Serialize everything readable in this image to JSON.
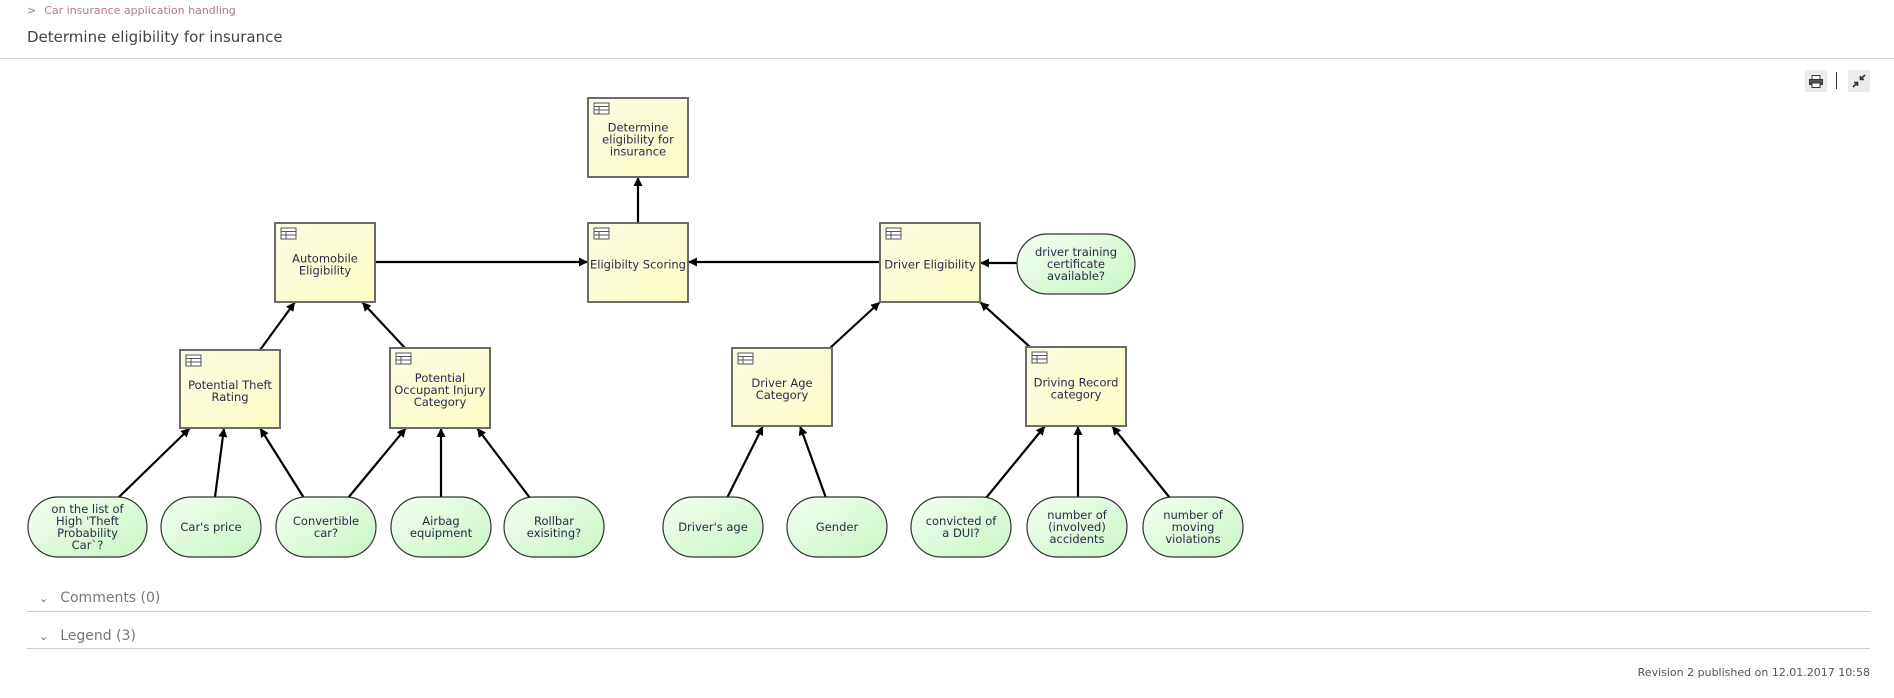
{
  "breadcrumb": {
    "chevron": ">",
    "parent": "Car insurance application handling"
  },
  "page": {
    "title": "Determine eligibility for insurance"
  },
  "toolbar": {
    "print_icon": "printer-icon",
    "collapse_icon": "collapse-arrows-icon"
  },
  "diagram": {
    "decisions": [
      {
        "id": "determine",
        "label": [
          "Determine",
          "eligibility for",
          "insurance"
        ]
      },
      {
        "id": "automobile",
        "label": [
          "Automobile",
          "Eligibility"
        ]
      },
      {
        "id": "scoring",
        "label": [
          "Eligibilty Scoring"
        ]
      },
      {
        "id": "driver",
        "label": [
          "Driver Eligibility"
        ]
      },
      {
        "id": "theft",
        "label": [
          "Potential Theft",
          "Rating"
        ]
      },
      {
        "id": "occupant",
        "label": [
          "Potential",
          "Occupant Injury",
          "Category"
        ]
      },
      {
        "id": "age",
        "label": [
          "Driver Age",
          "Category"
        ]
      },
      {
        "id": "record",
        "label": [
          "Driving Record",
          "category"
        ]
      }
    ],
    "inputs": [
      {
        "id": "training",
        "label": [
          "driver training",
          "certificate",
          "available?"
        ]
      },
      {
        "id": "highTheft",
        "label": [
          "on the list of",
          "High 'Theft",
          "Probability",
          "Car`?"
        ]
      },
      {
        "id": "price",
        "label": [
          "Car's price"
        ]
      },
      {
        "id": "convertible",
        "label": [
          "Convertible",
          "car?"
        ]
      },
      {
        "id": "airbag",
        "label": [
          "Airbag",
          "equipment"
        ]
      },
      {
        "id": "rollbar",
        "label": [
          "Rollbar",
          "exisiting?"
        ]
      },
      {
        "id": "driversAge",
        "label": [
          "Driver's age"
        ]
      },
      {
        "id": "gender",
        "label": [
          "Gender"
        ]
      },
      {
        "id": "dui",
        "label": [
          "convicted of",
          "a DUI?"
        ]
      },
      {
        "id": "accidents",
        "label": [
          "number of",
          "(involved)",
          "accidents"
        ]
      },
      {
        "id": "violations",
        "label": [
          "number of",
          "moving",
          "violations"
        ]
      }
    ],
    "edges": [
      [
        "scoring",
        "determine"
      ],
      [
        "automobile",
        "scoring"
      ],
      [
        "driver",
        "scoring"
      ],
      [
        "training",
        "driver"
      ],
      [
        "theft",
        "automobile"
      ],
      [
        "occupant",
        "automobile"
      ],
      [
        "age",
        "driver"
      ],
      [
        "record",
        "driver"
      ],
      [
        "highTheft",
        "theft"
      ],
      [
        "price",
        "theft"
      ],
      [
        "convertible",
        "theft"
      ],
      [
        "convertible",
        "occupant"
      ],
      [
        "airbag",
        "occupant"
      ],
      [
        "rollbar",
        "occupant"
      ],
      [
        "driversAge",
        "age"
      ],
      [
        "gender",
        "age"
      ],
      [
        "dui",
        "record"
      ],
      [
        "accidents",
        "record"
      ],
      [
        "violations",
        "record"
      ]
    ]
  },
  "sections": {
    "comments": "Comments (0)",
    "legend": "Legend (3)"
  },
  "footer": {
    "revision": "Revision 2 published on 12.01.2017 10:58"
  }
}
